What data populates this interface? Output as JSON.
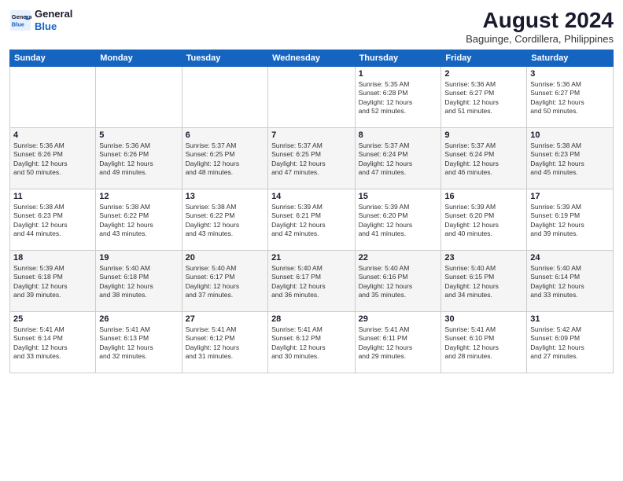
{
  "logo": {
    "line1": "General",
    "line2": "Blue"
  },
  "title": "August 2024",
  "subtitle": "Baguinge, Cordillera, Philippines",
  "weekdays": [
    "Sunday",
    "Monday",
    "Tuesday",
    "Wednesday",
    "Thursday",
    "Friday",
    "Saturday"
  ],
  "weeks": [
    [
      {
        "day": "",
        "content": ""
      },
      {
        "day": "",
        "content": ""
      },
      {
        "day": "",
        "content": ""
      },
      {
        "day": "",
        "content": ""
      },
      {
        "day": "1",
        "content": "Sunrise: 5:35 AM\nSunset: 6:28 PM\nDaylight: 12 hours\nand 52 minutes."
      },
      {
        "day": "2",
        "content": "Sunrise: 5:36 AM\nSunset: 6:27 PM\nDaylight: 12 hours\nand 51 minutes."
      },
      {
        "day": "3",
        "content": "Sunrise: 5:36 AM\nSunset: 6:27 PM\nDaylight: 12 hours\nand 50 minutes."
      }
    ],
    [
      {
        "day": "4",
        "content": "Sunrise: 5:36 AM\nSunset: 6:26 PM\nDaylight: 12 hours\nand 50 minutes."
      },
      {
        "day": "5",
        "content": "Sunrise: 5:36 AM\nSunset: 6:26 PM\nDaylight: 12 hours\nand 49 minutes."
      },
      {
        "day": "6",
        "content": "Sunrise: 5:37 AM\nSunset: 6:25 PM\nDaylight: 12 hours\nand 48 minutes."
      },
      {
        "day": "7",
        "content": "Sunrise: 5:37 AM\nSunset: 6:25 PM\nDaylight: 12 hours\nand 47 minutes."
      },
      {
        "day": "8",
        "content": "Sunrise: 5:37 AM\nSunset: 6:24 PM\nDaylight: 12 hours\nand 47 minutes."
      },
      {
        "day": "9",
        "content": "Sunrise: 5:37 AM\nSunset: 6:24 PM\nDaylight: 12 hours\nand 46 minutes."
      },
      {
        "day": "10",
        "content": "Sunrise: 5:38 AM\nSunset: 6:23 PM\nDaylight: 12 hours\nand 45 minutes."
      }
    ],
    [
      {
        "day": "11",
        "content": "Sunrise: 5:38 AM\nSunset: 6:23 PM\nDaylight: 12 hours\nand 44 minutes."
      },
      {
        "day": "12",
        "content": "Sunrise: 5:38 AM\nSunset: 6:22 PM\nDaylight: 12 hours\nand 43 minutes."
      },
      {
        "day": "13",
        "content": "Sunrise: 5:38 AM\nSunset: 6:22 PM\nDaylight: 12 hours\nand 43 minutes."
      },
      {
        "day": "14",
        "content": "Sunrise: 5:39 AM\nSunset: 6:21 PM\nDaylight: 12 hours\nand 42 minutes."
      },
      {
        "day": "15",
        "content": "Sunrise: 5:39 AM\nSunset: 6:20 PM\nDaylight: 12 hours\nand 41 minutes."
      },
      {
        "day": "16",
        "content": "Sunrise: 5:39 AM\nSunset: 6:20 PM\nDaylight: 12 hours\nand 40 minutes."
      },
      {
        "day": "17",
        "content": "Sunrise: 5:39 AM\nSunset: 6:19 PM\nDaylight: 12 hours\nand 39 minutes."
      }
    ],
    [
      {
        "day": "18",
        "content": "Sunrise: 5:39 AM\nSunset: 6:18 PM\nDaylight: 12 hours\nand 39 minutes."
      },
      {
        "day": "19",
        "content": "Sunrise: 5:40 AM\nSunset: 6:18 PM\nDaylight: 12 hours\nand 38 minutes."
      },
      {
        "day": "20",
        "content": "Sunrise: 5:40 AM\nSunset: 6:17 PM\nDaylight: 12 hours\nand 37 minutes."
      },
      {
        "day": "21",
        "content": "Sunrise: 5:40 AM\nSunset: 6:17 PM\nDaylight: 12 hours\nand 36 minutes."
      },
      {
        "day": "22",
        "content": "Sunrise: 5:40 AM\nSunset: 6:16 PM\nDaylight: 12 hours\nand 35 minutes."
      },
      {
        "day": "23",
        "content": "Sunrise: 5:40 AM\nSunset: 6:15 PM\nDaylight: 12 hours\nand 34 minutes."
      },
      {
        "day": "24",
        "content": "Sunrise: 5:40 AM\nSunset: 6:14 PM\nDaylight: 12 hours\nand 33 minutes."
      }
    ],
    [
      {
        "day": "25",
        "content": "Sunrise: 5:41 AM\nSunset: 6:14 PM\nDaylight: 12 hours\nand 33 minutes."
      },
      {
        "day": "26",
        "content": "Sunrise: 5:41 AM\nSunset: 6:13 PM\nDaylight: 12 hours\nand 32 minutes."
      },
      {
        "day": "27",
        "content": "Sunrise: 5:41 AM\nSunset: 6:12 PM\nDaylight: 12 hours\nand 31 minutes."
      },
      {
        "day": "28",
        "content": "Sunrise: 5:41 AM\nSunset: 6:12 PM\nDaylight: 12 hours\nand 30 minutes."
      },
      {
        "day": "29",
        "content": "Sunrise: 5:41 AM\nSunset: 6:11 PM\nDaylight: 12 hours\nand 29 minutes."
      },
      {
        "day": "30",
        "content": "Sunrise: 5:41 AM\nSunset: 6:10 PM\nDaylight: 12 hours\nand 28 minutes."
      },
      {
        "day": "31",
        "content": "Sunrise: 5:42 AM\nSunset: 6:09 PM\nDaylight: 12 hours\nand 27 minutes."
      }
    ]
  ]
}
